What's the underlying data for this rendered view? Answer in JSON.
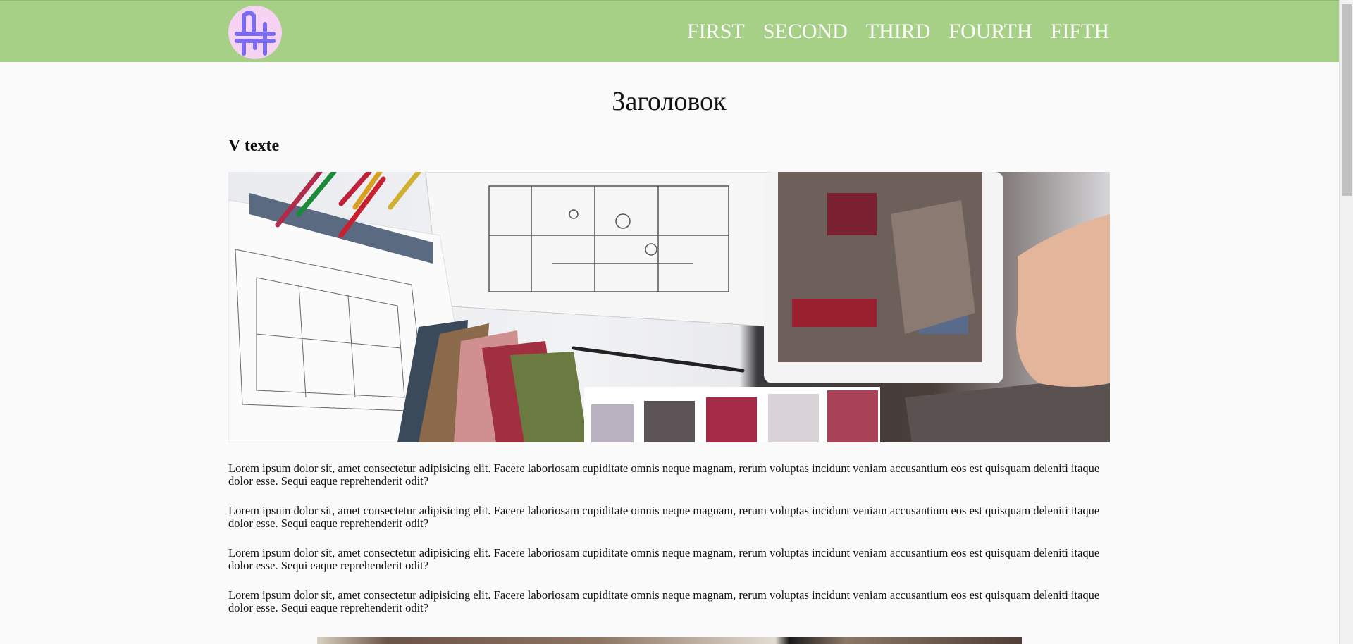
{
  "nav": {
    "items": [
      "FIRST",
      "SECOND",
      "THIRD",
      "FOURTH",
      "FIFTH"
    ]
  },
  "main": {
    "title": "Заголовок",
    "subtitle": "V texte",
    "paragraphs": [
      "Lorem ipsum dolor sit, amet consectetur adipisicing elit. Facere laboriosam cupiditate omnis neque magnam, rerum voluptas incidunt veniam accusantium eos est quisquam deleniti itaque dolor esse. Sequi eaque reprehenderit odit?",
      "Lorem ipsum dolor sit, amet consectetur adipisicing elit. Facere laboriosam cupiditate omnis neque magnam, rerum voluptas incidunt veniam accusantium eos est quisquam deleniti itaque dolor esse. Sequi eaque reprehenderit odit?",
      "Lorem ipsum dolor sit, amet consectetur adipisicing elit. Facere laboriosam cupiditate omnis neque magnam, rerum voluptas incidunt veniam accusantium eos est quisquam deleniti itaque dolor esse. Sequi eaque reprehenderit odit?",
      "Lorem ipsum dolor sit, amet consectetur adipisicing elit. Facere laboriosam cupiditate omnis neque magnam, rerum voluptas incidunt veniam accusantium eos est quisquam deleniti itaque dolor esse. Sequi eaque reprehenderit odit?"
    ]
  },
  "colors": {
    "header_bg": "#a5d086",
    "logo_bg": "#f7d3f3",
    "logo_mark": "#7a6cf2",
    "page_bg": "#fafafa"
  },
  "icons": {
    "logo": "furniture-logo-icon"
  }
}
